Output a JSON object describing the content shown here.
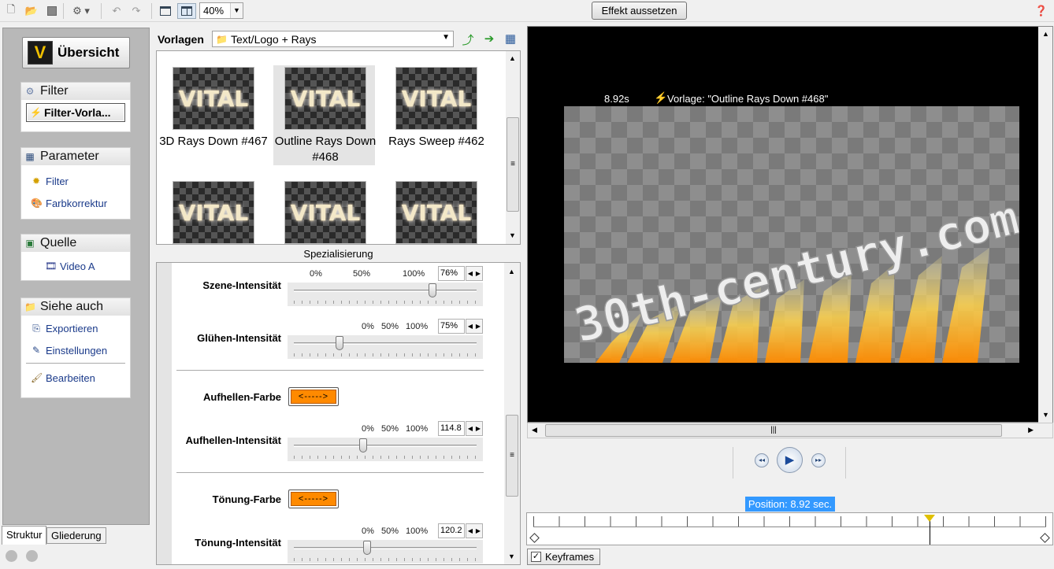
{
  "toolbar": {
    "zoom_value": "40%",
    "effekt_button": "Effekt aussetzen",
    "icons": [
      "new-file-icon",
      "open-folder-icon",
      "save-icon",
      "render-icon",
      "undo-icon",
      "redo-icon",
      "single-view-icon",
      "split-view-icon",
      "help-icon"
    ]
  },
  "left_panel": {
    "overview_button": "Übersicht",
    "filter": {
      "title": "Filter",
      "button": "Filter-Vorla..."
    },
    "parameter": {
      "title": "Parameter",
      "items": [
        "Filter",
        "Farbkorrektur"
      ]
    },
    "quelle": {
      "title": "Quelle",
      "items": [
        "Video A"
      ]
    },
    "siehe_auch": {
      "title": "Siehe auch",
      "items": [
        "Exportieren",
        "Einstellungen",
        "Bearbeiten"
      ]
    },
    "tabs": [
      "Struktur",
      "Gliederung"
    ]
  },
  "vorlagen": {
    "label": "Vorlagen",
    "folder": "Text/Logo + Rays",
    "thumb_text": "VITAL",
    "templates": [
      {
        "name": "3D Rays Down #467"
      },
      {
        "name": "Outline Rays Down #468",
        "selected": true
      },
      {
        "name": "Rays Sweep #462"
      },
      {
        "name": ""
      },
      {
        "name": ""
      },
      {
        "name": ""
      }
    ]
  },
  "spezialisierung": {
    "title": "Spezialisierung",
    "scale_labels": [
      "0%",
      "50%",
      "100%"
    ],
    "params": [
      {
        "label": "Szene-Intensität",
        "value": "76%",
        "level": 0.76
      },
      {
        "label": "Glühen-Intensität",
        "value": "75%",
        "level": 0.25
      },
      {
        "label": "Aufhellen-Farbe",
        "swatch": "<----->",
        "color": "#ff8a00"
      },
      {
        "label": "Aufhellen-Intensität",
        "value": "114.8",
        "level": 0.38
      },
      {
        "label": "Tönung-Farbe",
        "swatch": "<----->",
        "color": "#ff8a00"
      },
      {
        "label": "Tönung-Intensität",
        "value": "120.2",
        "level": 0.4
      }
    ]
  },
  "preview": {
    "time": "8.92s",
    "template_info": "Vorlage: \"Outline Rays Down #468\"",
    "watermark": "30th-century.com"
  },
  "timeline": {
    "position_badge": "Position: 8.92 sec.",
    "keyframes_label": "Keyframes",
    "keyframes_checked": true,
    "position_fraction": 0.772
  }
}
